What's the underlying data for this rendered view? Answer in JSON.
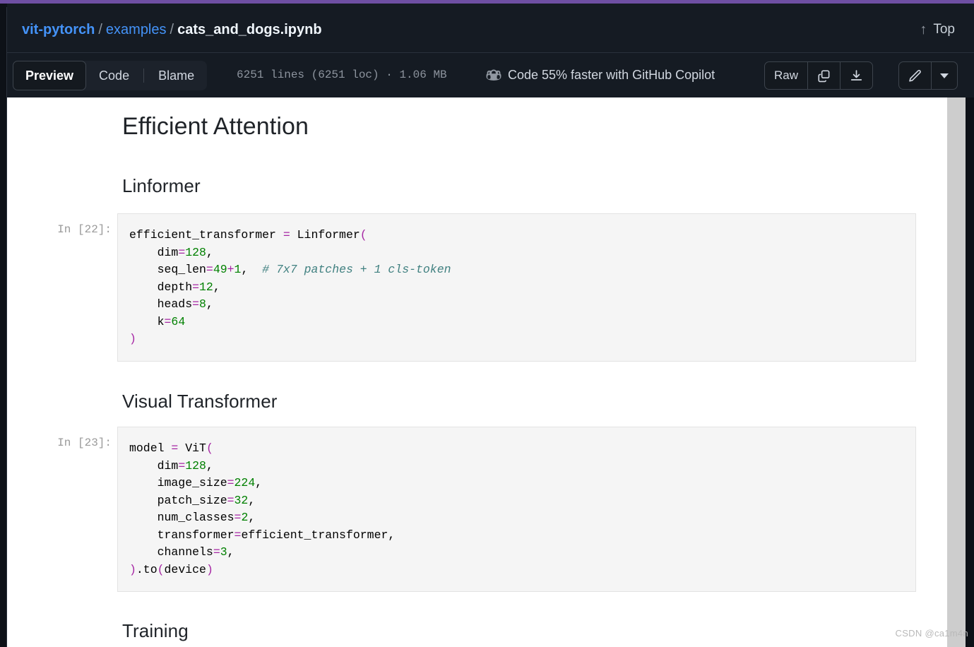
{
  "window": {
    "accent_purple": "#6e4fa3",
    "header_bg": "#151b23",
    "page_bg": "#0d1117",
    "link_blue": "#4493f8"
  },
  "breadcrumb": {
    "repo": "vit-pytorch",
    "separator": "/",
    "directory": "examples",
    "file": "cats_and_dogs.ipynb"
  },
  "header": {
    "top_label": "Top",
    "top_icon": "arrow-up-icon"
  },
  "toolbar": {
    "tabs": [
      {
        "label": "Preview",
        "selected": true
      },
      {
        "label": "Code",
        "selected": false
      },
      {
        "label": "Blame",
        "selected": false
      }
    ],
    "file_meta": "6251 lines (6251 loc) · 1.06 MB",
    "copilot_text": "Code 55% faster with GitHub Copilot",
    "copilot_icon": "copilot-icon",
    "raw_label": "Raw",
    "copy_icon": "copy-icon",
    "download_icon": "download-icon",
    "edit_icon": "pencil-icon",
    "caret_icon": "chevron-down-icon"
  },
  "notebook": {
    "h1": "Efficient Attention",
    "h2_linformer": "Linformer",
    "h2_visual": "Visual Transformer",
    "h2_training": "Training",
    "cells": [
      {
        "prompt": "In [22]:",
        "source": "efficient_transformer = Linformer(\n    dim=128,\n    seq_len=49+1,  # 7x7 patches + 1 cls-token\n    depth=12,\n    heads=8,\n    k=64\n)"
      },
      {
        "prompt": "In [23]:",
        "source": "model = ViT(\n    dim=128,\n    image_size=224,\n    patch_size=32,\n    num_classes=2,\n    transformer=efficient_transformer,\n    channels=3,\n).to(device)"
      }
    ]
  },
  "watermark": "CSDN @ca1m4n"
}
